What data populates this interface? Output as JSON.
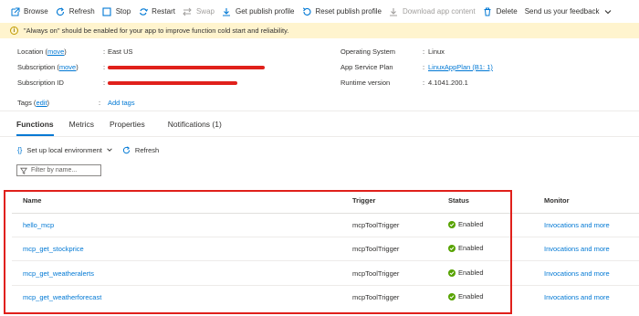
{
  "toolbar": {
    "items": [
      {
        "label": "Browse",
        "icon": "external-link-icon",
        "disabled": false
      },
      {
        "label": "Refresh",
        "icon": "refresh-icon",
        "disabled": false
      },
      {
        "label": "Stop",
        "icon": "stop-icon",
        "disabled": false
      },
      {
        "label": "Restart",
        "icon": "restart-icon",
        "disabled": false
      },
      {
        "label": "Swap",
        "icon": "swap-icon",
        "disabled": true
      },
      {
        "label": "Get publish profile",
        "icon": "download-icon",
        "disabled": false
      },
      {
        "label": "Reset publish profile",
        "icon": "reset-icon",
        "disabled": false
      },
      {
        "label": "Download app content",
        "icon": "download-icon",
        "disabled": true
      },
      {
        "label": "Delete",
        "icon": "trash-icon",
        "disabled": false
      },
      {
        "label": "Send us your feedback",
        "icon": "chevron-down-icon",
        "disabled": false
      }
    ]
  },
  "banner": {
    "icon": "info-icon",
    "text": "\"Always on\" should be enabled for your app to improve function cold start and reliability."
  },
  "essentials": {
    "location_label": "Location",
    "location_move": "move",
    "location_value": "East US",
    "subscription_label": "Subscription",
    "subscription_move": "move",
    "subscription_id_label": "Subscription ID",
    "tags_label": "Tags",
    "tags_edit": "edit",
    "tags_add": "Add tags",
    "os_label": "Operating System",
    "os_value": "Linux",
    "plan_label": "App Service Plan",
    "plan_value": "LinuxAppPlan (B1: 1)",
    "runtime_label": "Runtime version",
    "runtime_value": "4.1041.200.1",
    "redaction_color": "#e0201b"
  },
  "tabs": [
    {
      "label": "Functions",
      "active": true
    },
    {
      "label": "Metrics",
      "active": false
    },
    {
      "label": "Properties",
      "active": false
    },
    {
      "label": "Notifications (1)",
      "active": false
    }
  ],
  "subtoolbar": {
    "setup_label": "Set up local environment",
    "refresh_label": "Refresh"
  },
  "filter": {
    "placeholder": "Filter by name..."
  },
  "table": {
    "headers": {
      "name": "Name",
      "trigger": "Trigger",
      "status": "Status",
      "monitor": "Monitor"
    },
    "rows": [
      {
        "name": "hello_mcp",
        "trigger": "mcpToolTrigger",
        "status": "Enabled",
        "monitor": "Invocations and more"
      },
      {
        "name": "mcp_get_stockprice",
        "trigger": "mcpToolTrigger",
        "status": "Enabled",
        "monitor": "Invocations and more"
      },
      {
        "name": "mcp_get_weatheralerts",
        "trigger": "mcpToolTrigger",
        "status": "Enabled",
        "monitor": "Invocations and more"
      },
      {
        "name": "mcp_get_weatherforecast",
        "trigger": "mcpToolTrigger",
        "status": "Enabled",
        "monitor": "Invocations and more"
      }
    ]
  },
  "colors": {
    "accent": "#0078d4",
    "status_ok": "#57a300",
    "highlight": "#e0201b",
    "banner_bg": "#fff4ce"
  }
}
